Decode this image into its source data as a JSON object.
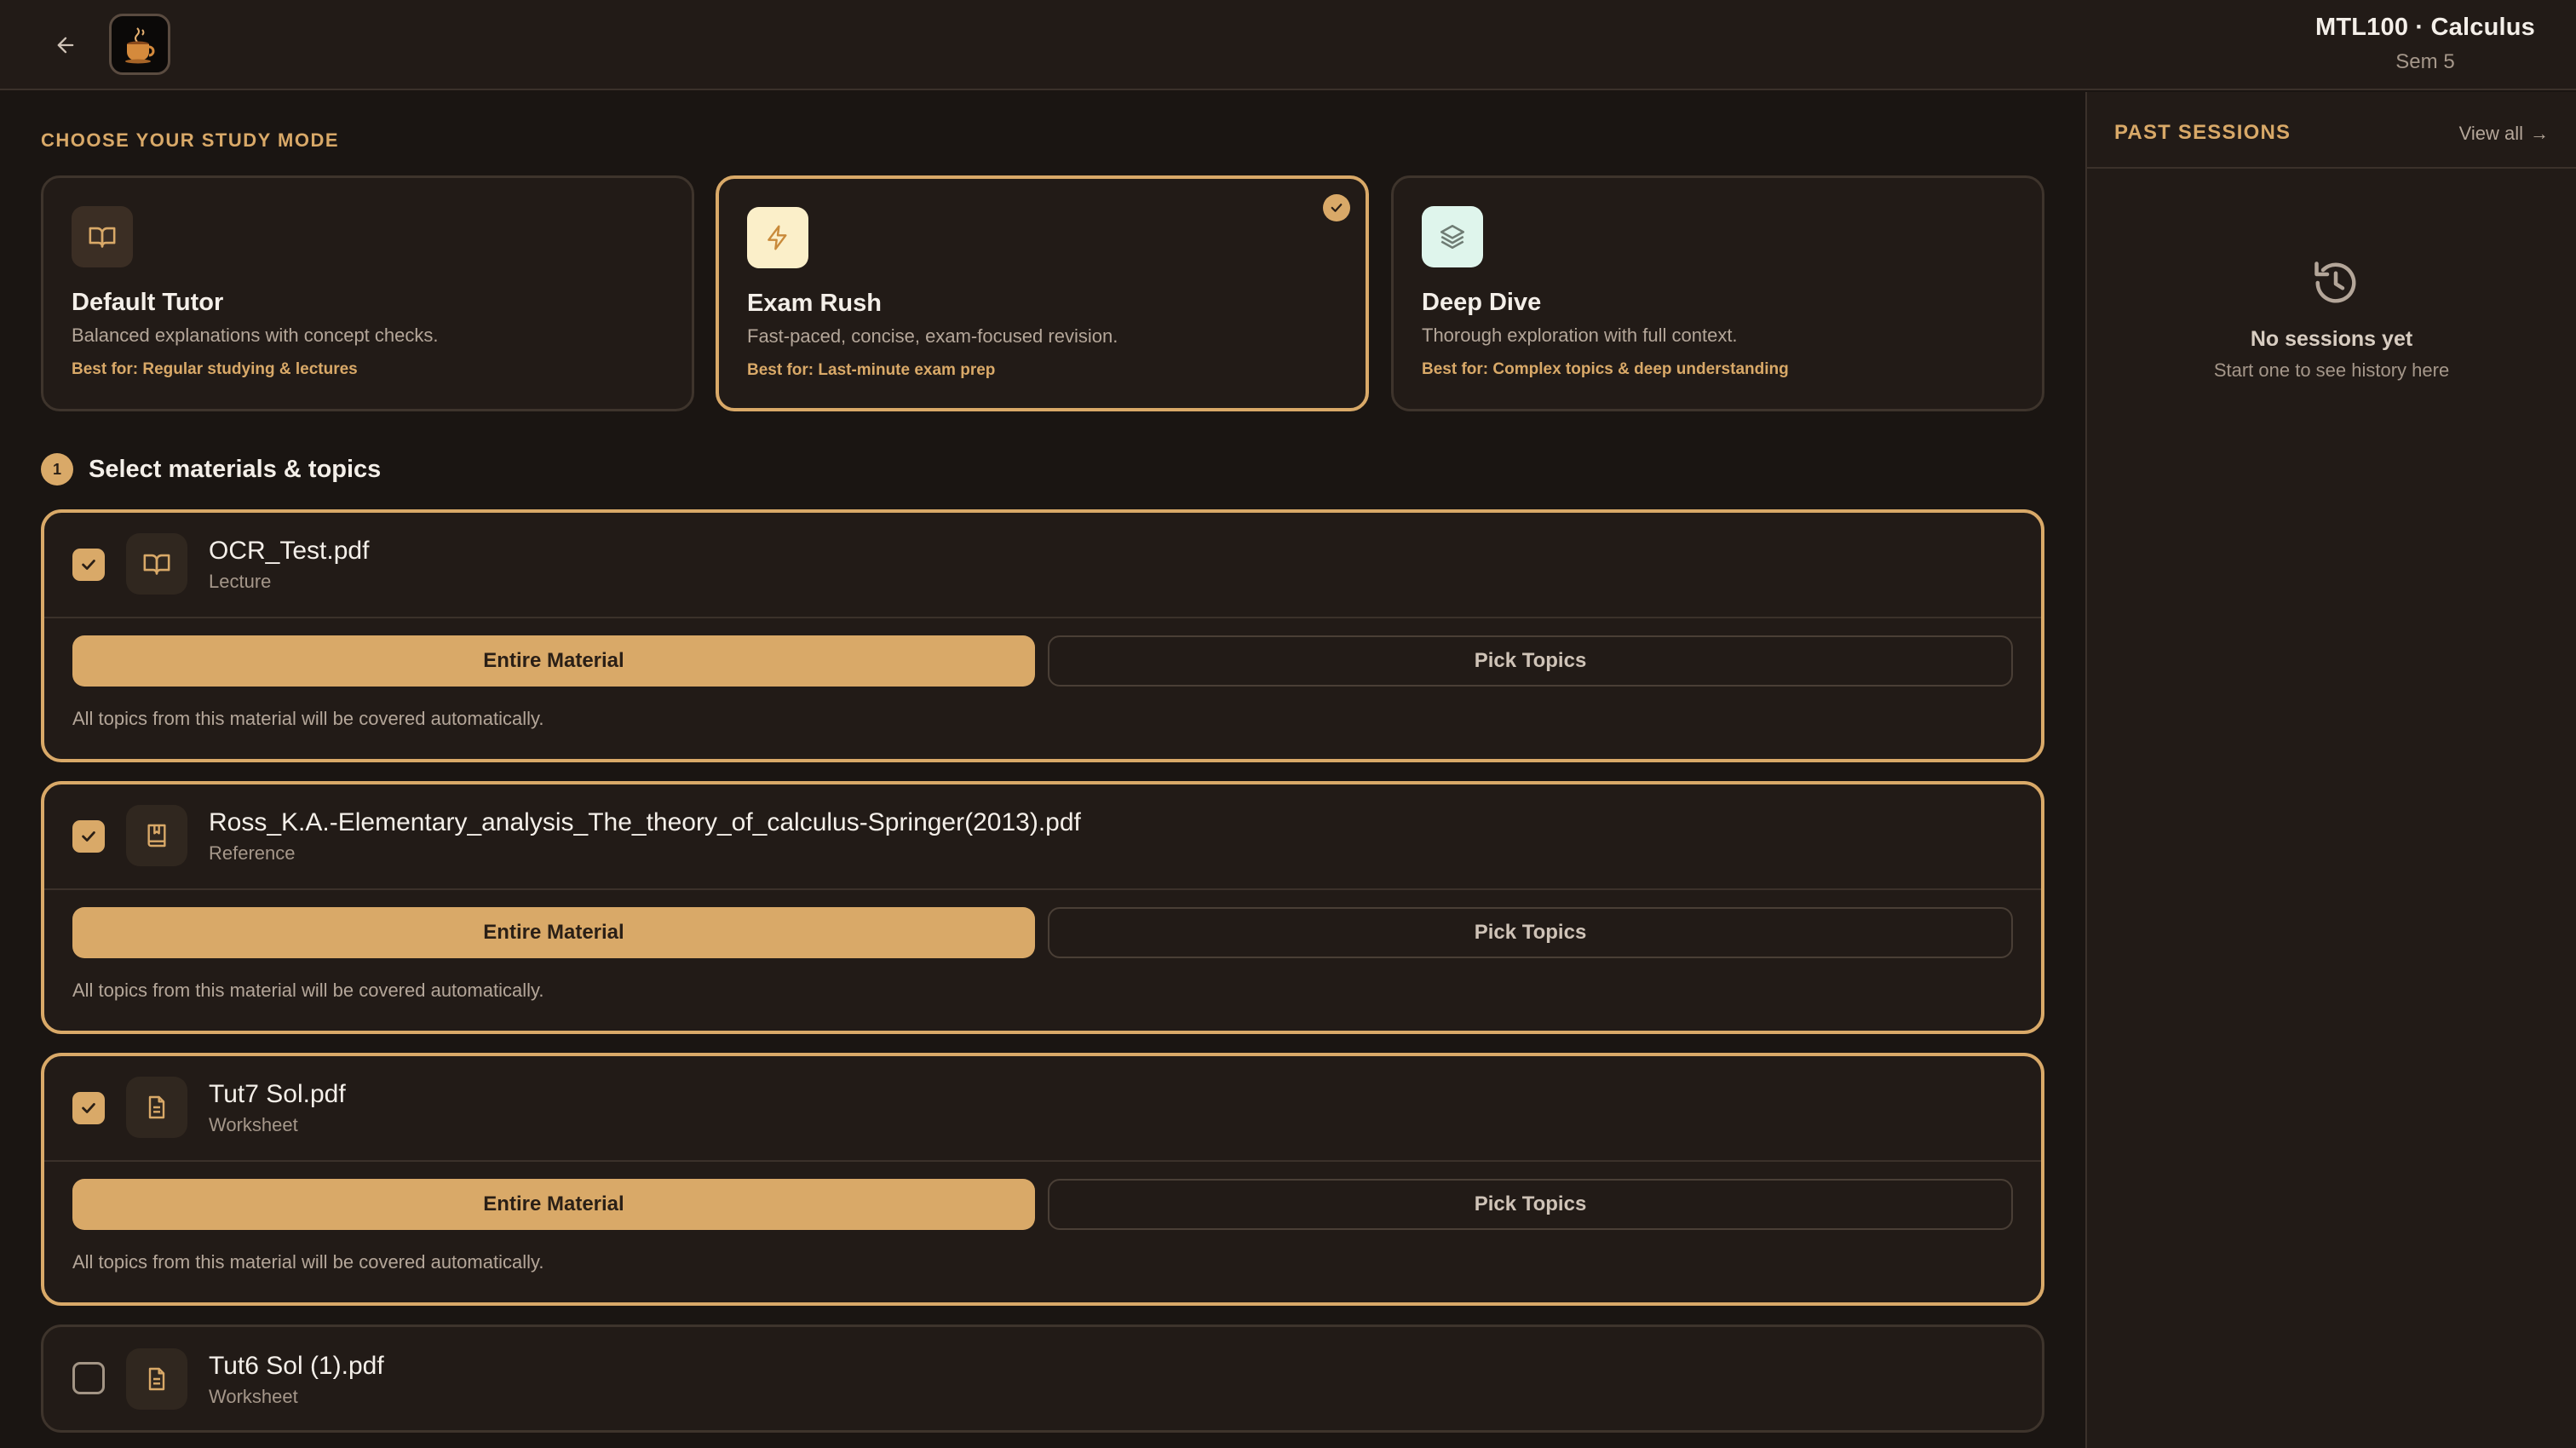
{
  "header": {
    "course_title": "MTL100 · Calculus",
    "course_sub": "Sem 5",
    "back_icon": "arrow-left-icon",
    "logo_icon": "coffee-cup-icon"
  },
  "study_mode": {
    "section_label": "CHOOSE YOUR STUDY MODE",
    "selected": "Exam Rush",
    "modes": [
      {
        "title": "Default Tutor",
        "description": "Balanced explanations with concept checks.",
        "best_for": "Best for: Regular studying & lectures",
        "icon": "book-open-icon",
        "icon_bg": "#3b2e24"
      },
      {
        "title": "Exam Rush",
        "description": "Fast-paced, concise, exam-focused revision.",
        "best_for": "Best for: Last-minute exam prep",
        "icon": "lightning-icon",
        "icon_bg": "#fbefc9"
      },
      {
        "title": "Deep Dive",
        "description": "Thorough exploration with full context.",
        "best_for": "Best for: Complex topics & deep understanding",
        "icon": "layers-icon",
        "icon_bg": "#dff5ec"
      }
    ]
  },
  "materials_section": {
    "step_number": "1",
    "title": "Select materials & topics",
    "entire_label": "Entire Material",
    "pick_label": "Pick Topics",
    "note": "All topics from this material will be covered automatically.",
    "items": [
      {
        "name": "OCR_Test.pdf",
        "type": "Lecture",
        "checked": true,
        "icon": "book-open-icon"
      },
      {
        "name": "Ross_K.A.-Elementary_analysis_The_theory_of_calculus-Springer(2013).pdf",
        "type": "Reference",
        "checked": true,
        "icon": "bookmark-book-icon"
      },
      {
        "name": "Tut7 Sol.pdf",
        "type": "Worksheet",
        "checked": true,
        "icon": "document-icon"
      },
      {
        "name": "Tut6 Sol (1).pdf",
        "type": "Worksheet",
        "checked": false,
        "icon": "document-icon"
      }
    ]
  },
  "sidebar": {
    "title": "PAST SESSIONS",
    "view_all": "View all",
    "view_all_arrow": "→",
    "empty_icon": "history-icon",
    "empty_title": "No sessions yet",
    "empty_sub": "Start one to see history here"
  },
  "colors": {
    "accent": "#d9a968",
    "background": "#1a1512",
    "surface": "#221b17"
  }
}
